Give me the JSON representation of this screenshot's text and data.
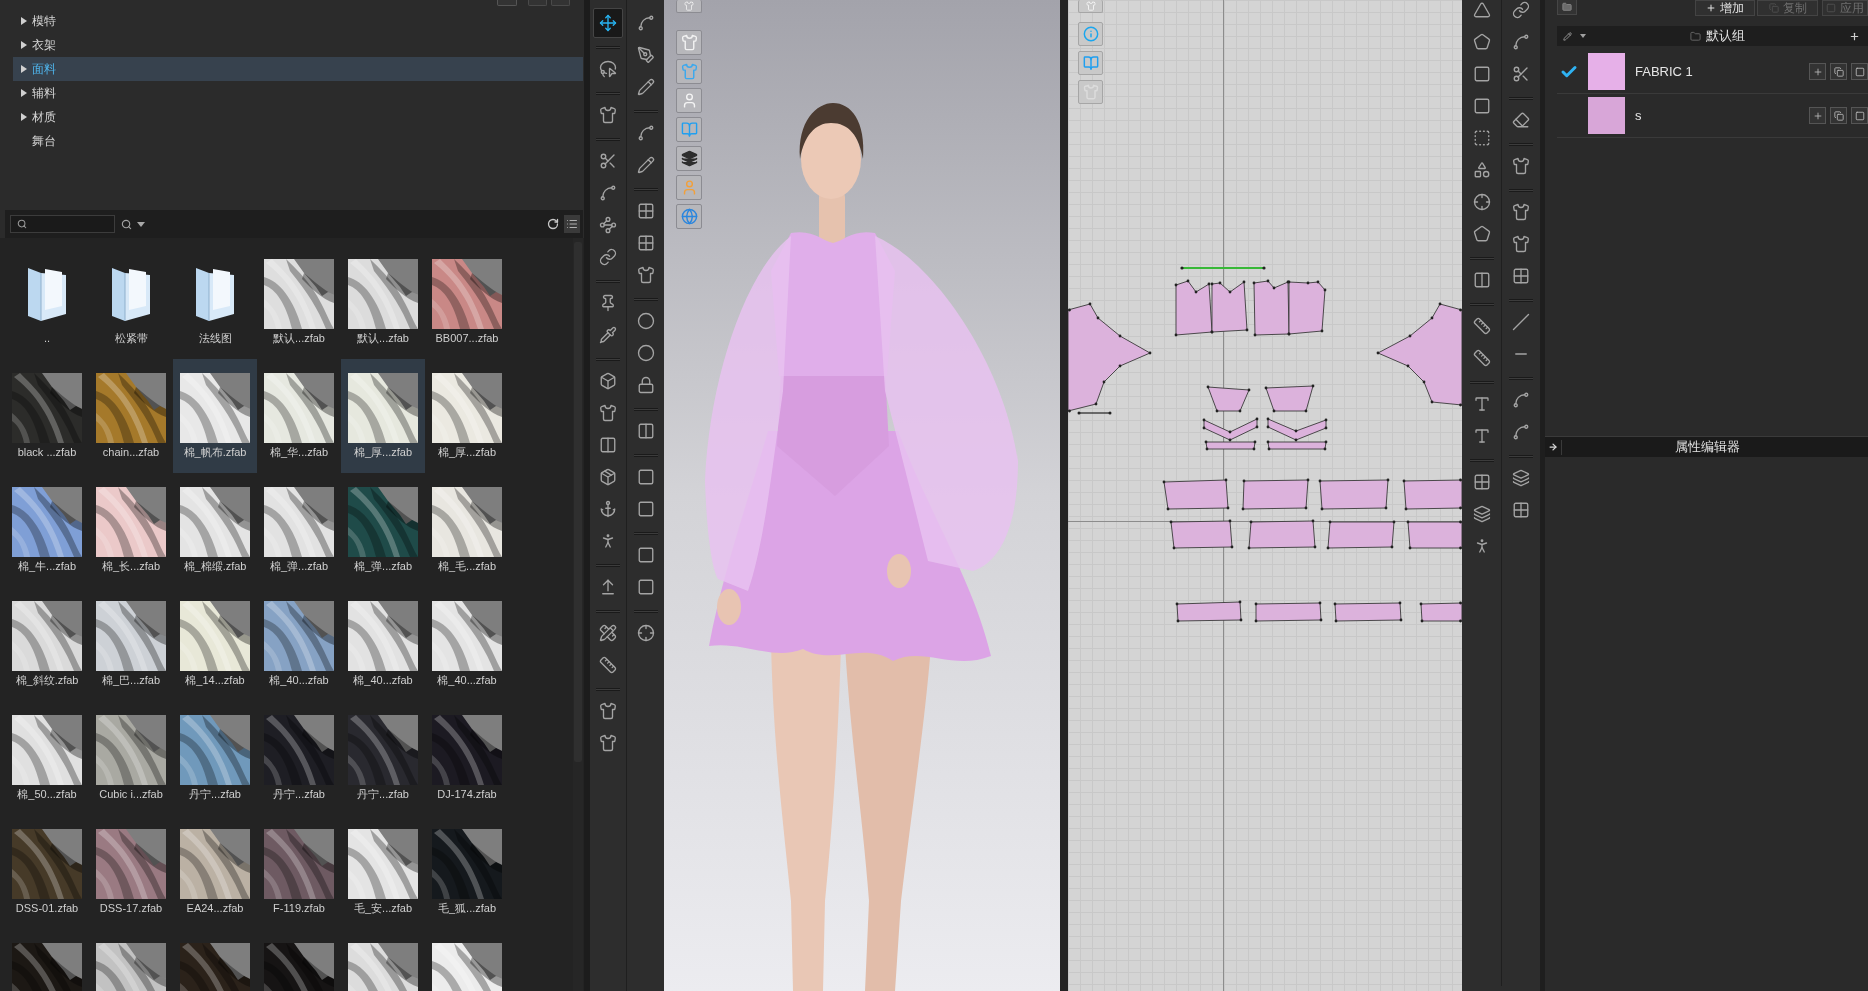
{
  "library": {
    "tree": [
      {
        "label": "模特",
        "expandable": true,
        "expanded": false,
        "selected": false
      },
      {
        "label": "衣架",
        "expandable": true,
        "expanded": false,
        "selected": false
      },
      {
        "label": "面料",
        "expandable": true,
        "expanded": false,
        "selected": true
      },
      {
        "label": "辅料",
        "expandable": true,
        "expanded": false,
        "selected": false
      },
      {
        "label": "材质",
        "expandable": true,
        "expanded": false,
        "selected": false
      },
      {
        "label": "舞台",
        "expandable": false,
        "selected": false
      }
    ],
    "items": [
      {
        "kind": "folder",
        "label": "..",
        "selected": false
      },
      {
        "kind": "folder",
        "label": "松紧带",
        "selected": false
      },
      {
        "kind": "folder",
        "label": "法线图",
        "selected": false
      },
      {
        "kind": "fabric",
        "label": "默认...zfab",
        "color": "#dedede",
        "selected": false
      },
      {
        "kind": "fabric",
        "label": "默认...zfab",
        "color": "#dcdcdc",
        "selected": false
      },
      {
        "kind": "fabric",
        "label": "BB007...zfab",
        "color": "#c98886",
        "selected": false
      },
      {
        "kind": "fabric",
        "label": "black ...zfab",
        "color": "#2c2c2a",
        "selected": false
      },
      {
        "kind": "fabric",
        "label": "chain...zfab",
        "color": "#a5792a",
        "selected": false
      },
      {
        "kind": "fabric",
        "label": "棉_帆布.zfab",
        "color": "#e8e8e8",
        "selected": true
      },
      {
        "kind": "fabric",
        "label": "棉_华...zfab",
        "color": "#e6e8e0",
        "selected": false
      },
      {
        "kind": "fabric",
        "label": "棉_厚...zfab",
        "color": "#e6e8de",
        "selected": true
      },
      {
        "kind": "fabric",
        "label": "棉_厚...zfab",
        "color": "#ebe9e1",
        "selected": false
      },
      {
        "kind": "fabric",
        "label": "棉_牛...zfab",
        "color": "#7f9fd6",
        "selected": false
      },
      {
        "kind": "fabric",
        "label": "棉_长...zfab",
        "color": "#ebc9c9",
        "selected": false
      },
      {
        "kind": "fabric",
        "label": "棉_棉缎.zfab",
        "color": "#e4e4e4",
        "selected": false
      },
      {
        "kind": "fabric",
        "label": "棉_弹...zfab",
        "color": "#e2e2e2",
        "selected": false
      },
      {
        "kind": "fabric",
        "label": "棉_弹...zfab",
        "color": "#1f4b49",
        "selected": false
      },
      {
        "kind": "fabric",
        "label": "棉_毛...zfab",
        "color": "#e8e6e0",
        "selected": false
      },
      {
        "kind": "fabric",
        "label": "棉_斜纹.zfab",
        "color": "#dadada",
        "selected": false
      },
      {
        "kind": "fabric",
        "label": "棉_巴...zfab",
        "color": "#cdd1d6",
        "selected": false
      },
      {
        "kind": "fabric",
        "label": "棉_14...zfab",
        "color": "#e8e8d8",
        "selected": false
      },
      {
        "kind": "fabric",
        "label": "棉_40...zfab",
        "color": "#86a2c4",
        "selected": false
      },
      {
        "kind": "fabric",
        "label": "棉_40...zfab",
        "color": "#e2e2e2",
        "selected": false
      },
      {
        "kind": "fabric",
        "label": "棉_40...zfab",
        "color": "#e4e4e4",
        "selected": false
      },
      {
        "kind": "fabric",
        "label": "棉_50...zfab",
        "color": "#e0e0e0",
        "selected": false
      },
      {
        "kind": "fabric",
        "label": "Cubic i...zfab",
        "color": "#a9a9a2",
        "selected": false
      },
      {
        "kind": "fabric",
        "label": "丹宁...zfab",
        "color": "#7099bb",
        "selected": false
      },
      {
        "kind": "fabric",
        "label": "丹宁...zfab",
        "color": "#1e1e24",
        "selected": false
      },
      {
        "kind": "fabric",
        "label": "丹宁...zfab",
        "color": "#29292f",
        "selected": false
      },
      {
        "kind": "fabric",
        "label": "DJ-174.zfab",
        "color": "#1c1a22",
        "selected": false
      },
      {
        "kind": "fabric",
        "label": "DSS-01.zfab",
        "color": "#463a28",
        "selected": false
      },
      {
        "kind": "fabric",
        "label": "DSS-17.zfab",
        "color": "#9a7a82",
        "selected": false
      },
      {
        "kind": "fabric",
        "label": "EA24...zfab",
        "color": "#bbb1a4",
        "selected": false
      },
      {
        "kind": "fabric",
        "label": "F-119.zfab",
        "color": "#6e5a62",
        "selected": false
      },
      {
        "kind": "fabric",
        "label": "毛_安...zfab",
        "color": "#e4e4e4",
        "selected": false
      },
      {
        "kind": "fabric",
        "label": "毛_狐...zfab",
        "color": "#15191d",
        "selected": false
      },
      {
        "kind": "fabric",
        "color": "#1c1814",
        "selected": false
      },
      {
        "kind": "fabric",
        "color": "#c2c2c2",
        "selected": false
      },
      {
        "kind": "fabric",
        "color": "#2b221a",
        "selected": false
      },
      {
        "kind": "fabric",
        "color": "#161414",
        "selected": false
      },
      {
        "kind": "fabric",
        "color": "#dcdcdc",
        "selected": false
      },
      {
        "kind": "fabric",
        "color": "#ececec",
        "selected": false
      }
    ]
  },
  "toolbar_3d": {
    "column_1": [
      [
        {
          "selected": true
        }
      ],
      [
        {
          "selected": false
        }
      ],
      [
        {
          "selected": false
        }
      ],
      [
        {
          "selected": false
        },
        {
          "selected": false
        },
        {
          "selected": false
        },
        {
          "selected": false
        }
      ],
      [
        {
          "selected": false
        },
        {
          "selected": false
        }
      ],
      [
        {
          "selected": false
        },
        {
          "selected": false
        },
        {
          "selected": false
        },
        {
          "selected": false
        },
        {
          "selected": false
        },
        {
          "selected": false
        }
      ],
      [
        {
          "selected": false
        }
      ],
      [
        {
          "selected": false
        },
        {
          "selected": false
        }
      ],
      [
        {
          "selected": false
        },
        {
          "selected": false
        }
      ]
    ],
    "column_2": [
      [
        {
          "selected": false
        },
        {
          "selected": false
        },
        {
          "selected": false
        }
      ],
      [
        {
          "selected": false
        },
        {
          "selected": false
        }
      ],
      [
        {
          "selected": false
        },
        {
          "selected": false
        },
        {
          "selected": false
        }
      ],
      [
        {
          "selected": false
        },
        {
          "selected": false
        },
        {
          "selected": false
        }
      ],
      [
        {
          "selected": false
        }
      ],
      [
        {
          "selected": false
        },
        {
          "selected": false
        }
      ],
      [
        {
          "selected": false
        },
        {
          "selected": false
        }
      ],
      [
        {
          "selected": false
        }
      ]
    ]
  },
  "fabric_panel": {
    "buttons": [
      {
        "label": "增加",
        "disabled": false
      },
      {
        "label": "复制",
        "disabled": true
      },
      {
        "label": "应用",
        "disabled": true
      }
    ],
    "group": "默认组",
    "fabrics": [
      {
        "name": "FABRIC 1",
        "checked": true,
        "color": "#e6b0e8"
      },
      {
        "name": "s",
        "checked": false,
        "color": "#d8a6d8"
      }
    ]
  },
  "property_editor": {
    "title": "属性编辑器"
  }
}
